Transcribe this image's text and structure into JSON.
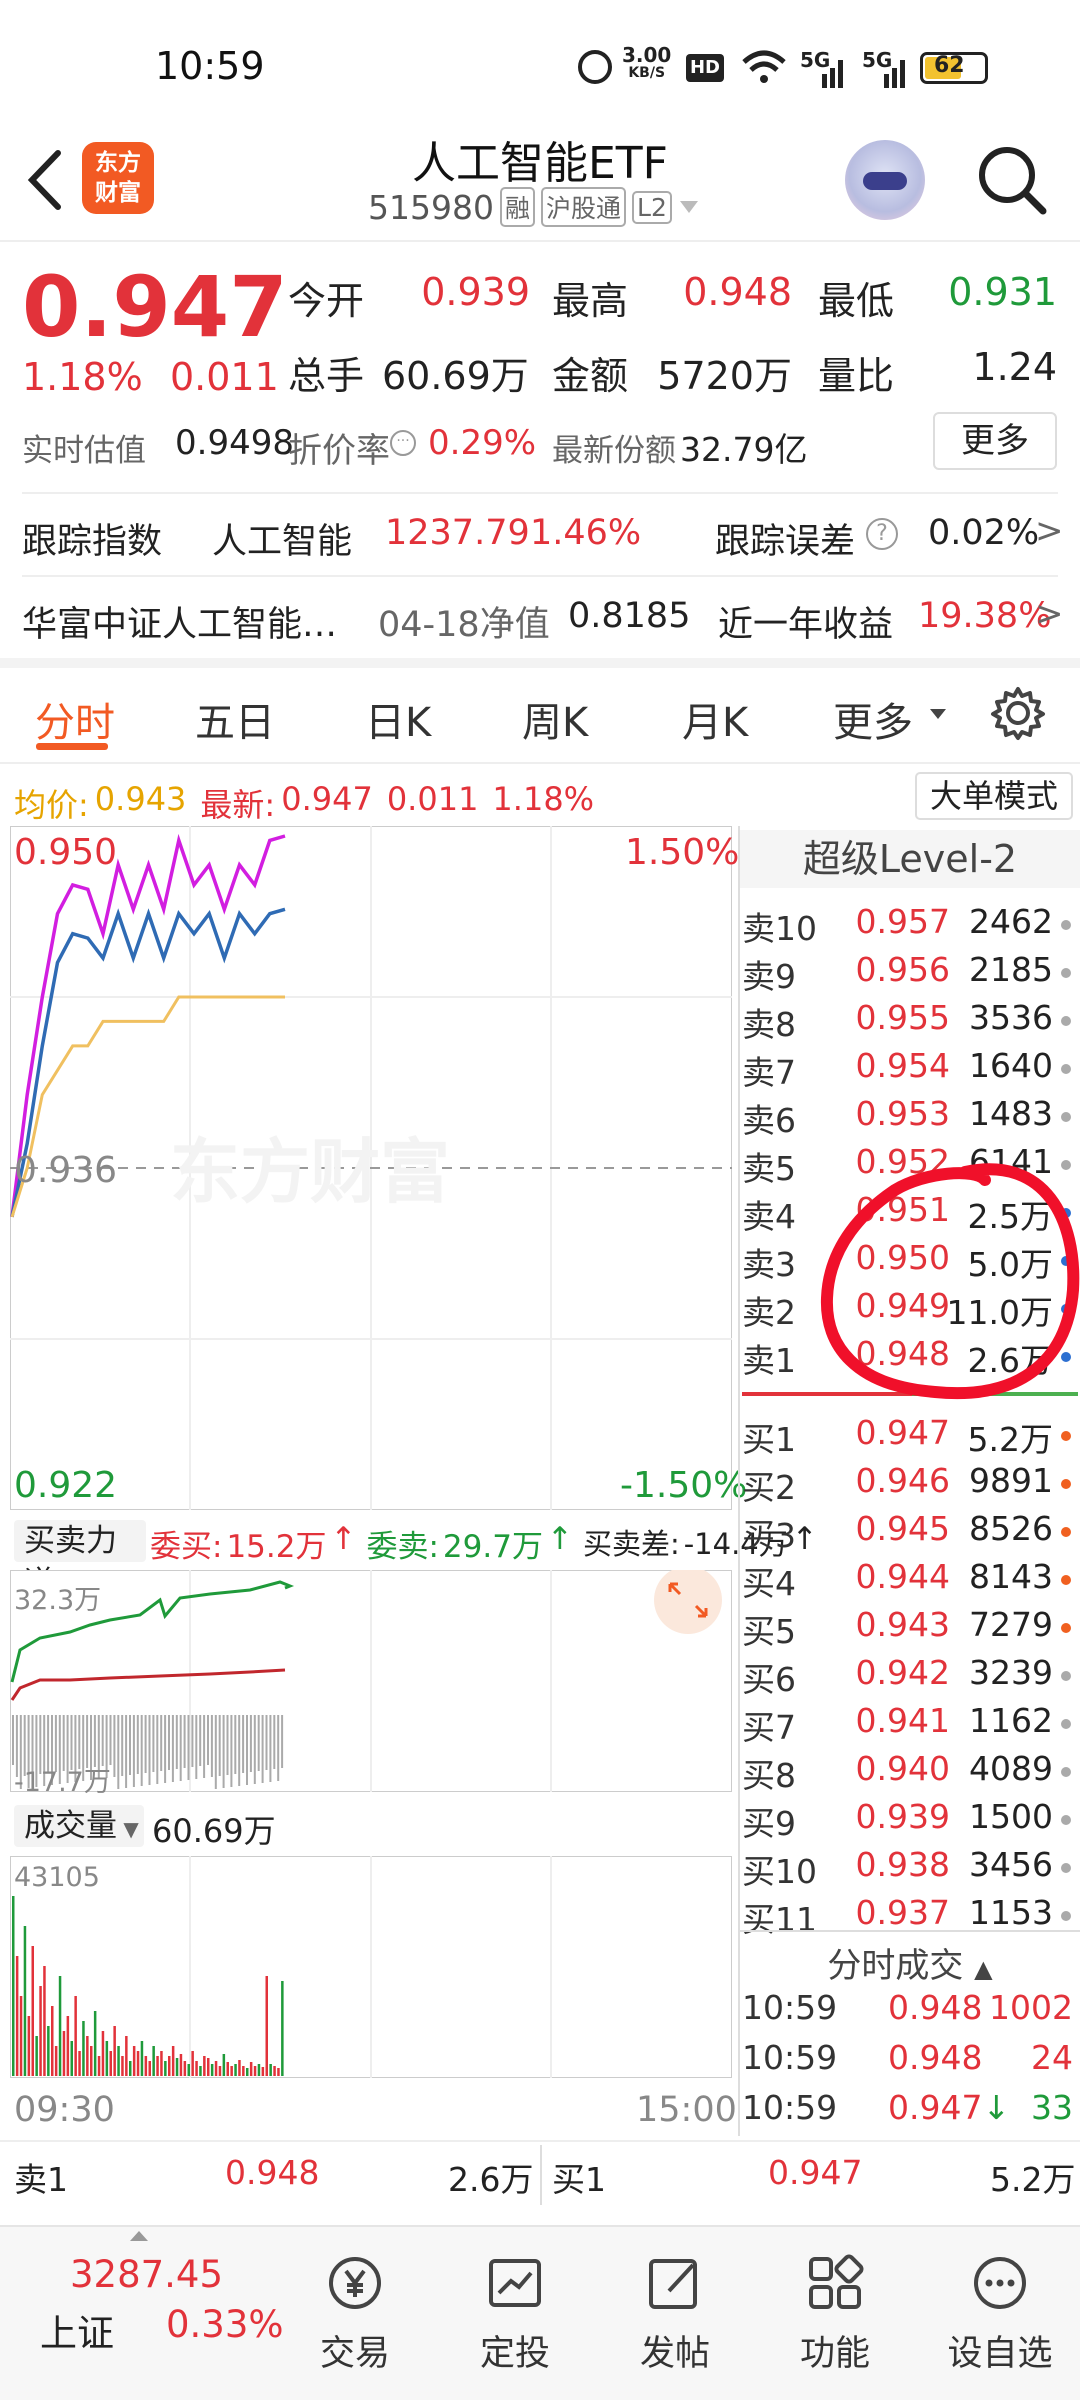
{
  "status": {
    "time": "10:59",
    "net_speed_top": "3.00",
    "net_speed_unit": "KB/S",
    "hd": "HD",
    "signal1": "5G",
    "signal2": "5G",
    "battery": "62"
  },
  "header": {
    "title": "人工智能ETF",
    "code": "515980",
    "badges": [
      "融",
      "沪股通",
      "L2"
    ],
    "logo_line1": "东方",
    "logo_line2": "财富"
  },
  "quote": {
    "price": "0.947",
    "pct": "1.18%",
    "chg": "0.011",
    "open_label": "今开",
    "open": "0.939",
    "high_label": "最高",
    "high": "0.948",
    "low_label": "最低",
    "low": "0.931",
    "vol_label": "总手",
    "vol": "60.69万",
    "amt_label": "金额",
    "amt": "5720万",
    "ratio_label": "量比",
    "ratio": "1.24",
    "est_label": "实时估值",
    "est": "0.9498",
    "prem_label": "折价率",
    "prem": "0.29%",
    "shares_label": "最新份额",
    "shares": "32.79亿",
    "more": "更多"
  },
  "index": {
    "label": "跟踪指数",
    "name": "人工智能",
    "value": "1237.79",
    "pct": "1.46%",
    "err_label": "跟踪误差",
    "err": "0.02%"
  },
  "fund": {
    "name": "华富中证人工智能…",
    "nav_label": "04-18净值",
    "nav": "0.8185",
    "yr_label": "近一年收益",
    "yr": "19.38%"
  },
  "tabs": [
    "分时",
    "五日",
    "日K",
    "周K",
    "月K",
    "更多"
  ],
  "chart": {
    "avg_label": "均价:",
    "avg": "0.943",
    "last_label": "最新:",
    "last": "0.947",
    "chg": "0.011",
    "pct": "1.18%",
    "mode": "大单模式",
    "ymax": "0.950",
    "ymid": "0.936",
    "ymin": "0.922",
    "pmax": "1.50%",
    "pmin": "-1.50%",
    "watermark": "东方财富",
    "force_label": "买卖力道",
    "bid_label": "委买:",
    "bid": "15.2万",
    "ask_label": "委卖:",
    "ask": "29.7万",
    "diff_label": "买卖差:",
    "diff": "-14.4万",
    "force_top": "32.3万",
    "force_bot": "-17.7万",
    "vol_label": "成交量",
    "vol": "60.69万",
    "vol_max": "43105",
    "t_start": "09:30",
    "t_end": "15:00"
  },
  "chart_data": {
    "type": "line",
    "x": [
      "09:30",
      "09:35",
      "09:40",
      "09:45",
      "09:50",
      "09:55",
      "10:00",
      "10:05",
      "10:10",
      "10:15",
      "10:20",
      "10:25",
      "10:30",
      "10:35",
      "10:40",
      "10:45",
      "10:50",
      "10:55",
      "10:59"
    ],
    "series": [
      {
        "values": [
          0.934,
          0.939,
          0.943,
          0.946,
          0.948,
          0.947,
          0.946,
          0.948,
          0.947,
          0.948,
          0.947,
          0.949,
          0.948,
          0.948,
          0.947,
          0.948,
          0.948,
          0.949,
          0.95
        ]
      },
      {
        "values": [
          0.934,
          0.937,
          0.941,
          0.944,
          0.946,
          0.945,
          0.945,
          0.946,
          0.945,
          0.946,
          0.945,
          0.946,
          0.946,
          0.946,
          0.945,
          0.946,
          0.946,
          0.946,
          0.947
        ]
      },
      {
        "values": [
          0.934,
          0.936,
          0.939,
          0.94,
          0.941,
          0.941,
          0.942,
          0.942,
          0.942,
          0.942,
          0.942,
          0.943,
          0.943,
          0.943,
          0.943,
          0.943,
          0.943,
          0.943,
          0.943
        ]
      }
    ],
    "ylim": [
      0.922,
      0.95
    ]
  },
  "orderbook": {
    "title": "超级Level-2",
    "asks": [
      [
        "卖10",
        "0.957",
        "2462"
      ],
      [
        "卖9",
        "0.956",
        "2185"
      ],
      [
        "卖8",
        "0.955",
        "3536"
      ],
      [
        "卖7",
        "0.954",
        "1640"
      ],
      [
        "卖6",
        "0.953",
        "1483"
      ],
      [
        "卖5",
        "0.952",
        "6141"
      ],
      [
        "卖4",
        "0.951",
        "2.5万"
      ],
      [
        "卖3",
        "0.950",
        "5.0万"
      ],
      [
        "卖2",
        "0.949",
        "11.0万"
      ],
      [
        "卖1",
        "0.948",
        "2.6万"
      ]
    ],
    "bids": [
      [
        "买1",
        "0.947",
        "5.2万"
      ],
      [
        "买2",
        "0.946",
        "9891"
      ],
      [
        "买3",
        "0.945",
        "8526"
      ],
      [
        "买4",
        "0.944",
        "8143"
      ],
      [
        "买5",
        "0.943",
        "7279"
      ],
      [
        "买6",
        "0.942",
        "3239"
      ],
      [
        "买7",
        "0.941",
        "1162"
      ],
      [
        "买8",
        "0.940",
        "4089"
      ],
      [
        "买9",
        "0.939",
        "1500"
      ],
      [
        "买10",
        "0.938",
        "3456"
      ],
      [
        "买11",
        "0.937",
        "1153"
      ]
    ]
  },
  "trades": {
    "title": "分时成交",
    "rows": [
      [
        "10:59",
        "0.948",
        "1002"
      ],
      [
        "10:59",
        "0.948",
        "24"
      ],
      [
        "10:59",
        "0.947↓",
        "33"
      ]
    ]
  },
  "bottom_quote": {
    "s1_label": "卖1",
    "s1_price": "0.948",
    "s1_vol": "2.6万",
    "b1_label": "买1",
    "b1_price": "0.947",
    "b1_vol": "5.2万"
  },
  "nav": {
    "index_value": "3287.45",
    "index_name": "上证",
    "index_pct": "0.33%",
    "items": [
      "交易",
      "定投",
      "发帖",
      "功能",
      "设自选"
    ]
  }
}
